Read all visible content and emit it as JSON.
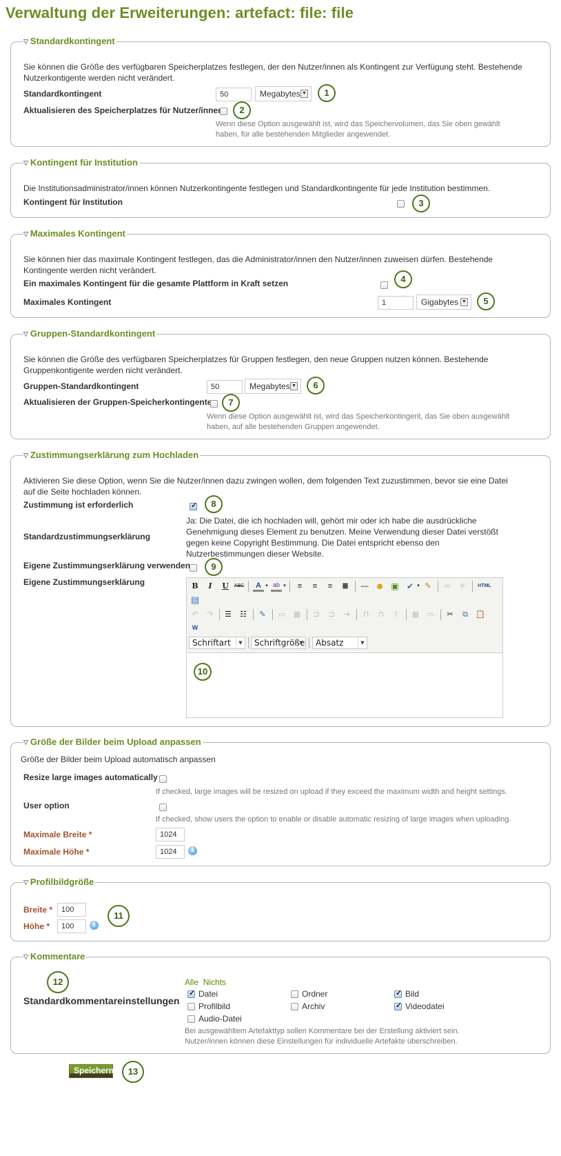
{
  "page_title": "Verwaltung der Erweiterungen: artefact: file: file",
  "sections": {
    "standard_quota": {
      "legend": "Standardkontingent",
      "description": "Sie können die Größe des verfügbaren Speicherplatzes festlegen, der den Nutzer/innen als Kontingent zur Verfügung steht. Bestehende Nutzerkontigente werden nicht verändert.",
      "quota_label": "Standardkontingent",
      "quota_value": "50",
      "quota_unit": "Megabytes",
      "update_label": "Aktualisieren des Speicherplatzes für Nutzer/innen",
      "update_checked": false,
      "update_hint": "Wenn diese Option ausgewählt ist, wird das Speichervolumen, das Sie oben gewählt haben, für alle bestehenden Mitglieder angewendet.",
      "callouts": [
        "1",
        "2"
      ]
    },
    "institution_quota": {
      "legend": "Kontingent für Institution",
      "description": "Die Institutionsadministrator/innen können Nutzerkontingente festlegen und Standardkontingente für jede Institution bestimmen.",
      "label": "Kontingent für Institution",
      "checked": false,
      "callout": "3"
    },
    "max_quota": {
      "legend": "Maximales Kontingent",
      "description": "Sie können hier das maximale Kontingent festlegen, das die Administrator/innen den Nutzer/innen zuweisen dürfen. Bestehende Kontingente werden nicht verändert.",
      "enforce_label": "Ein maximales Kontingent für die gesamte Plattform in Kraft setzen",
      "enforce_checked": false,
      "max_label": "Maximales Kontingent",
      "max_value": "1",
      "max_unit": "Gigabytes",
      "callouts": [
        "4",
        "5"
      ]
    },
    "group_quota": {
      "legend": "Gruppen-Standardkontingent",
      "description": "Sie können die Größe des verfügbaren Speicherplatzes für Gruppen festlegen, den neue Gruppen nutzen können. Bestehende Gruppenkontigente werden nicht verändert.",
      "quota_label": "Gruppen-Standardkontingent",
      "quota_value": "50",
      "quota_unit": "Megabytes",
      "update_label": "Aktualisieren der Gruppen-Speicherkontingente",
      "update_checked": false,
      "update_hint": "Wenn diese Option ausgewählt ist, wird das Speicherkontingent, das Sie oben ausgewählt haben, auf alle bestehenden Gruppen angewendet.",
      "callouts": [
        "6",
        "7"
      ]
    },
    "upload_agreement": {
      "legend": "Zustimmungserklärung zum Hochladen",
      "description": "Aktivieren Sie diese Option, wenn Sie die Nutzer/innen dazu zwingen wollen, dem folgenden Text zuzustimmen, bevor sie eine Datei auf die Seite hochladen können.",
      "required_label": "Zustimmung ist erforderlich",
      "required_checked": true,
      "default_label": "Standardzustimmungserklärung",
      "default_text": "Ja: Die Datei, die ich hochladen will, gehört mir oder ich habe die ausdrückliche Genehmigung dieses Element zu benutzen. Meine Verwendung dieser Datei verstößt gegen keine Copyright Bestimmung. Die Datei entspricht ebenso den Nutzerbestimmungen dieser Website.",
      "custom_use_label": "Eigene Zustimmungserklärung verwenden",
      "custom_use_checked": false,
      "custom_label": "Eigene Zustimmungserklärung",
      "editor": {
        "toolbar_row1": [
          "bold",
          "italic",
          "underline",
          "strikethrough",
          "text-color",
          "highlight-color",
          "align-left",
          "align-center",
          "align-right",
          "align-justify",
          "horizontal-rule",
          "emoticons",
          "image",
          "spellcheck",
          "cleanup",
          "link",
          "unlink",
          "html-source",
          "fullscreen"
        ],
        "toolbar_row2": [
          "undo",
          "redo",
          "bullet-list",
          "numbered-list",
          "edit-table",
          "row-props",
          "cell-props",
          "insert-row-before",
          "insert-row-after",
          "delete-row",
          "insert-col-before",
          "insert-col-after",
          "delete-col",
          "split-cells",
          "merge-cells",
          "cut",
          "copy",
          "paste",
          "paste-word"
        ],
        "font_family": "Schriftart",
        "font_size": "Schriftgröße",
        "format": "Absatz",
        "content": ""
      },
      "callouts": [
        "8",
        "9",
        "10"
      ]
    },
    "resize_images": {
      "legend": "Größe der Bilder beim Upload anpassen",
      "description": "Größe der Bilder beim Upload automatisch anpassen",
      "auto_label": "Resize large images automatically",
      "auto_checked": false,
      "auto_hint": "If checked, large images will be resized on upload if they exceed the maximum width and height settings.",
      "user_option_label": "User option",
      "user_option_checked": false,
      "user_option_hint": "If checked, show users the option to enable or disable automatic resizing of large images when uploading.",
      "max_width_label": "Maximale Breite *",
      "max_width_value": "1024",
      "max_height_label": "Maximale Höhe *",
      "max_height_value": "1024"
    },
    "profile_image_size": {
      "legend": "Profilbildgröße",
      "width_label": "Breite *",
      "width_value": "100",
      "height_label": "Höhe *",
      "height_value": "100",
      "callout": "11"
    },
    "comments": {
      "legend": "Kommentare",
      "label": "Standardkommentareinstellungen",
      "select_all": "Alle",
      "select_none": "Nichts",
      "options": [
        {
          "label": "Datei",
          "checked": true
        },
        {
          "label": "Ordner",
          "checked": false
        },
        {
          "label": "Bild",
          "checked": true
        },
        {
          "label": "Profilbild",
          "checked": false
        },
        {
          "label": "Archiv",
          "checked": false
        },
        {
          "label": "Videodatei",
          "checked": true
        },
        {
          "label": "Audio-Datei",
          "checked": false
        }
      ],
      "hint": "Bei ausgewähltem Artefakttyp sollen Kommentare bei der Erstellung aktiviert sein. Nutzer/innen können diese Einstellungen für individuelle Artefakte überschreiben.",
      "callout": "12"
    }
  },
  "save_button": "Speichern",
  "save_callout": "13",
  "colors": {
    "accent": "#6b8e23",
    "required_label": "#a0522d",
    "callout_ring": "#4b7a1c",
    "fieldset_border": "#a9b8c2"
  }
}
